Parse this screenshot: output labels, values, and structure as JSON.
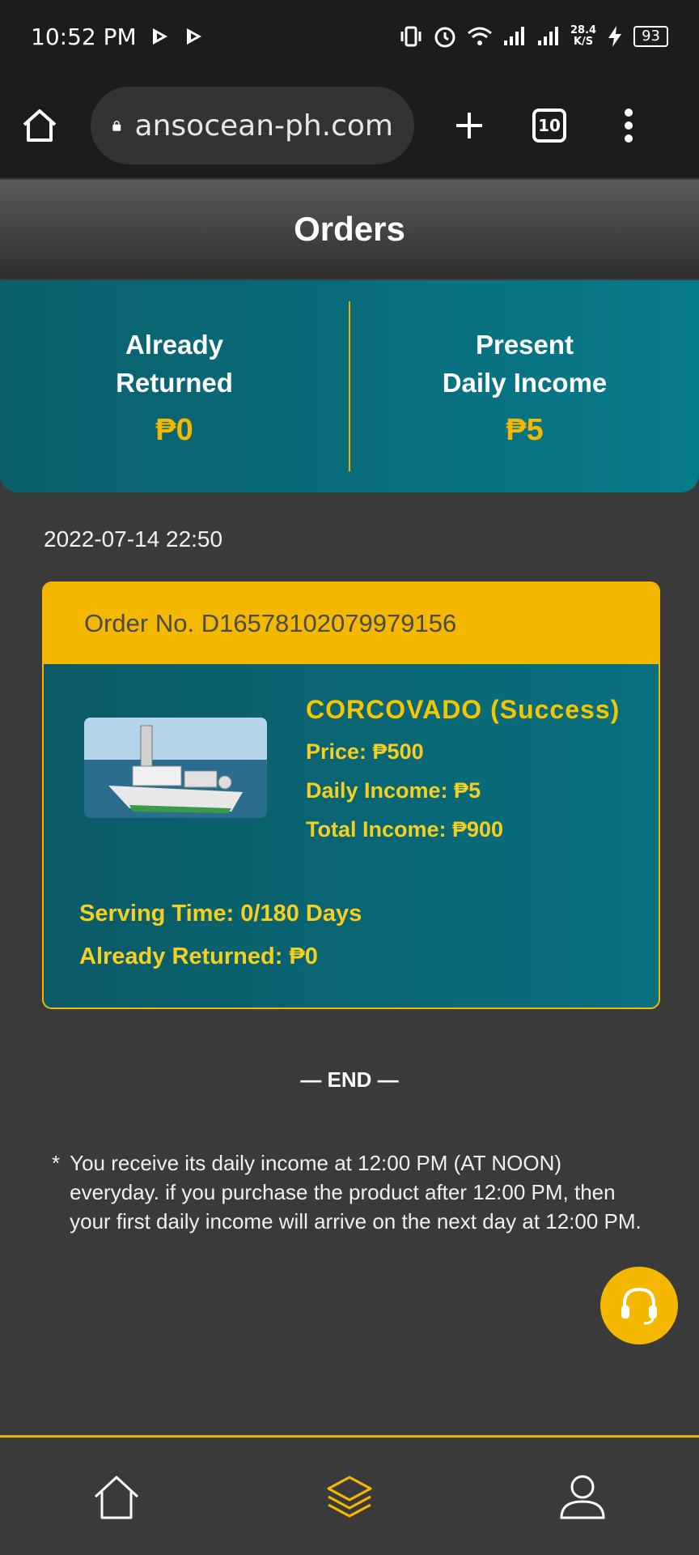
{
  "status_bar": {
    "time": "10:52 PM",
    "net_speed": "28.4",
    "net_unit": "K/S",
    "battery": "93"
  },
  "browser": {
    "url": "ansocean-ph.com",
    "tab_count": "10"
  },
  "page": {
    "title": "Orders"
  },
  "summary": {
    "already_returned_label_1": "Already",
    "already_returned_label_2": "Returned",
    "already_returned_value": "₱0",
    "daily_income_label_1": "Present",
    "daily_income_label_2": "Daily Income",
    "daily_income_value": "₱5"
  },
  "order": {
    "date": "2022-07-14 22:50",
    "order_no": "Order No. D16578102079979156",
    "product_name": "CORCOVADO",
    "status": "(Success)",
    "price": "Price: ₱500",
    "daily_income": "Daily Income: ₱5",
    "total_income": "Total Income: ₱900",
    "serving_time": "Serving Time: 0/180 Days",
    "already_returned": "Already Returned: ₱0"
  },
  "footer": {
    "end_text": "— END —",
    "note_marker": "*",
    "note": "You receive its daily income at 12:00 PM (AT NOON) everyday. if you purchase the product after 12:00 PM, then your first daily income will arrive on the next day at 12:00 PM."
  },
  "colors": {
    "accent": "#f5b800",
    "teal": "#0b5f6c",
    "background": "#3a3a3a"
  },
  "icons": {
    "nav": [
      "home-icon",
      "layers-icon",
      "user-icon"
    ],
    "support": "headset-icon"
  }
}
